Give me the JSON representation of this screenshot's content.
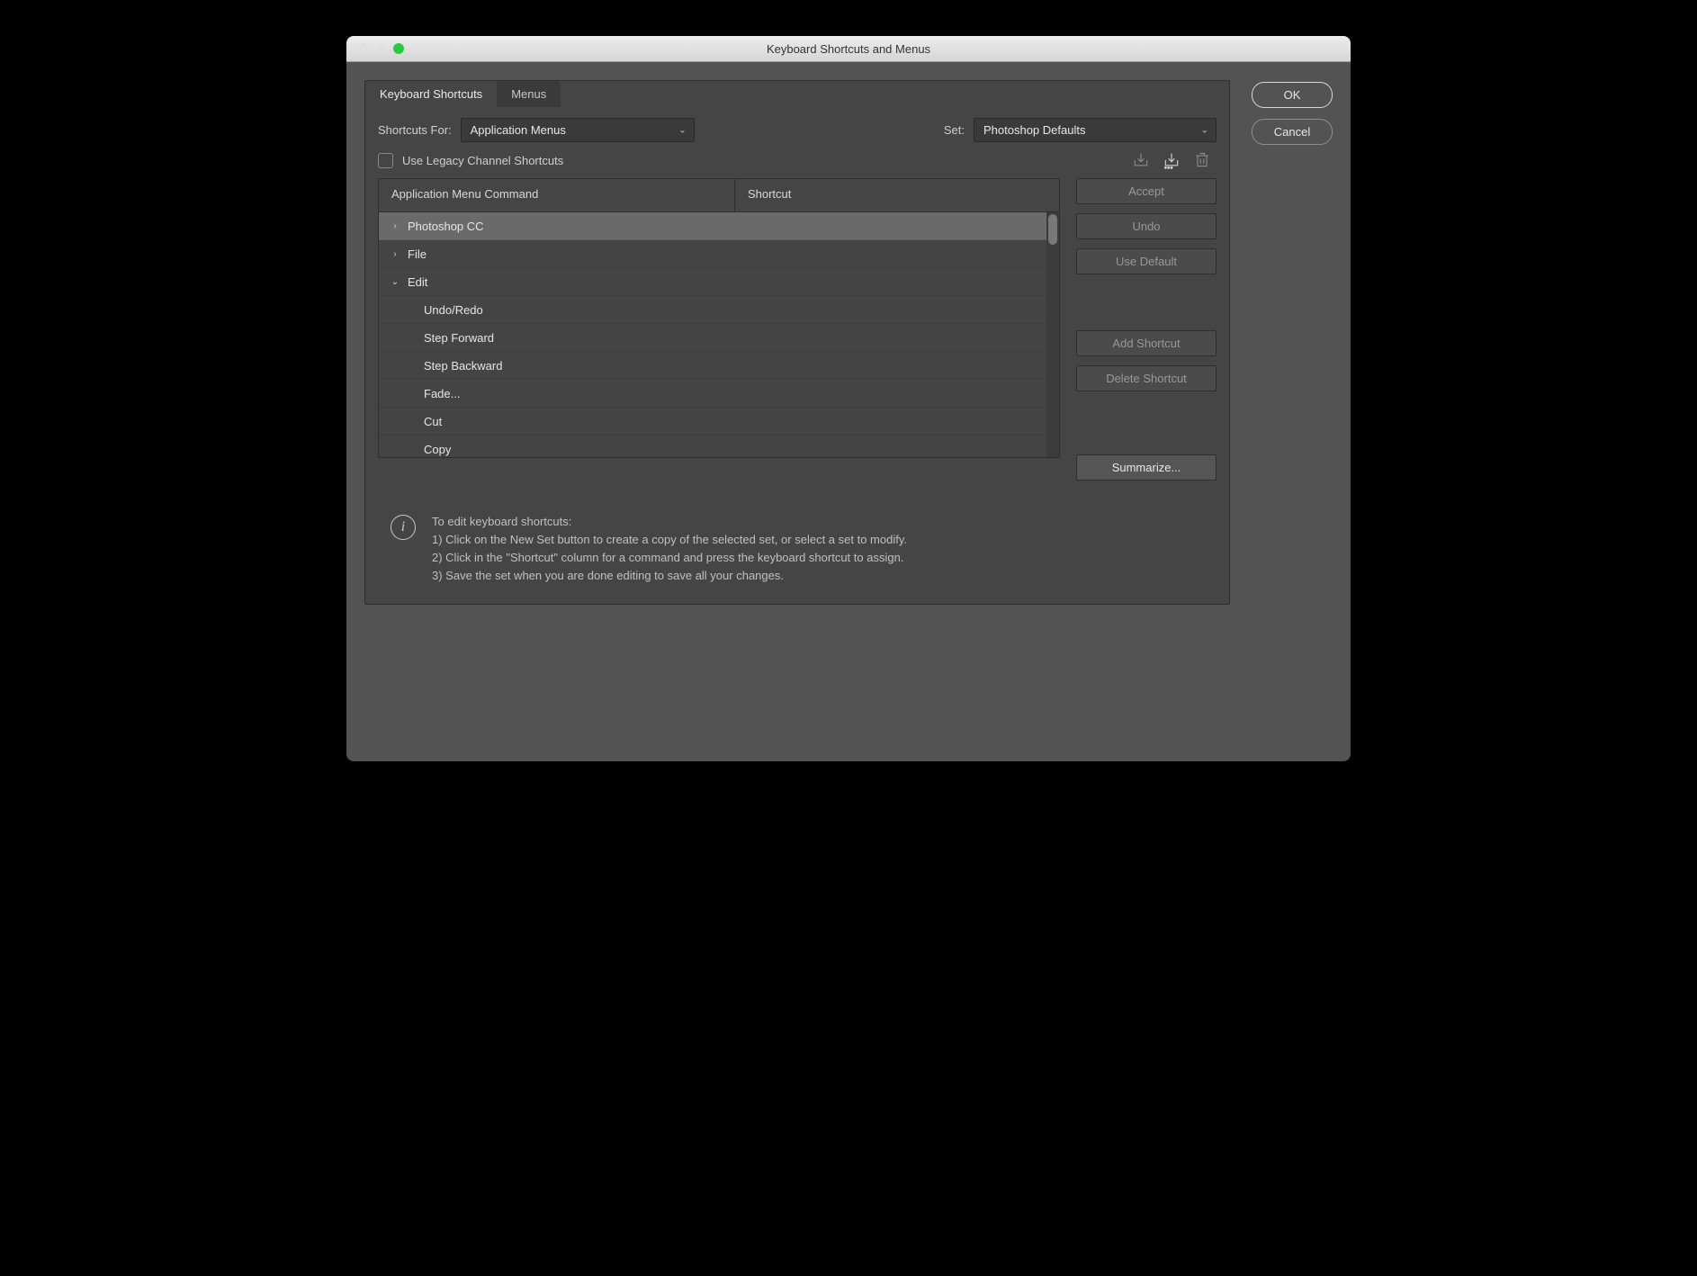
{
  "window": {
    "title": "Keyboard Shortcuts and Menus"
  },
  "side": {
    "ok": "OK",
    "cancel": "Cancel"
  },
  "tabs": {
    "shortcuts": "Keyboard Shortcuts",
    "menus": "Menus"
  },
  "shortcuts_for_label": "Shortcuts For:",
  "shortcuts_for_value": "Application Menus",
  "set_label": "Set:",
  "set_value": "Photoshop Defaults",
  "legacy_label": "Use Legacy Channel Shortcuts",
  "table": {
    "col1": "Application Menu Command",
    "col2": "Shortcut",
    "rows": [
      {
        "label": "Photoshop CC",
        "expand": "collapsed",
        "depth": 0,
        "selected": true
      },
      {
        "label": "File",
        "expand": "collapsed",
        "depth": 0
      },
      {
        "label": "Edit",
        "expand": "expanded",
        "depth": 0
      },
      {
        "label": "Undo/Redo",
        "depth": 1
      },
      {
        "label": "Step Forward",
        "depth": 1
      },
      {
        "label": "Step Backward",
        "depth": 1
      },
      {
        "label": "Fade...",
        "depth": 1
      },
      {
        "label": "Cut",
        "depth": 1
      },
      {
        "label": "Copy",
        "depth": 1
      }
    ]
  },
  "buttons": {
    "accept": "Accept",
    "undo": "Undo",
    "use_default": "Use Default",
    "add": "Add Shortcut",
    "delete": "Delete Shortcut",
    "summarize": "Summarize..."
  },
  "help": {
    "title": "To edit keyboard shortcuts:",
    "l1": "1) Click on the New Set button to create a copy of the selected set, or select a set to modify.",
    "l2": "2) Click in the \"Shortcut\" column for a command and press the keyboard shortcut to assign.",
    "l3": "3) Save the set when you are done editing to save all your changes."
  }
}
